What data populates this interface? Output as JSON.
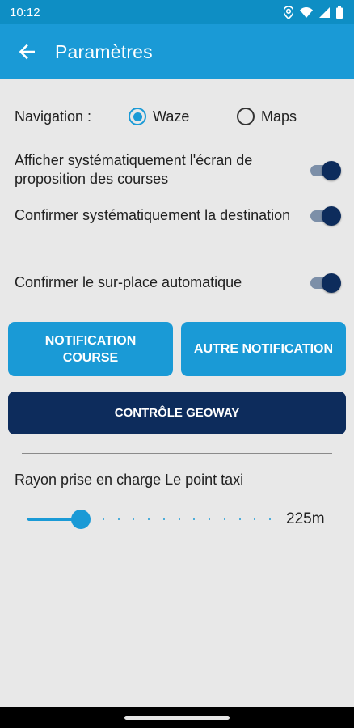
{
  "status_bar": {
    "time": "10:12",
    "icons": [
      "location-icon",
      "wifi-icon",
      "signal-icon",
      "battery-icon"
    ]
  },
  "app_bar": {
    "title": "Paramètres",
    "back_icon": "arrow-left-icon",
    "color": "#1a9ad6"
  },
  "navigation": {
    "label": "Navigation :",
    "options": [
      {
        "label": "Waze",
        "selected": true
      },
      {
        "label": "Maps",
        "selected": false
      }
    ]
  },
  "settings": [
    {
      "label": "Afficher systématiquement l'écran de proposition des courses",
      "enabled": true
    },
    {
      "label": "Confirmer systématiquement la destination",
      "enabled": true
    },
    {
      "label": "Confirmer le sur-place automatique",
      "enabled": true
    }
  ],
  "buttons": {
    "notification_course": "NOTIFICATION COURSE",
    "autre_notification": "AUTRE NOTIFICATION",
    "controle_geoway": "CONTRÔLE GEOWAY"
  },
  "radius": {
    "label": "Rayon prise en charge Le point taxi",
    "value_text": "225m",
    "fraction": 0.22,
    "steps": 16
  },
  "colors": {
    "primary": "#1a9ad6",
    "navy": "#0d2c5c",
    "background": "#e8e8e8"
  }
}
